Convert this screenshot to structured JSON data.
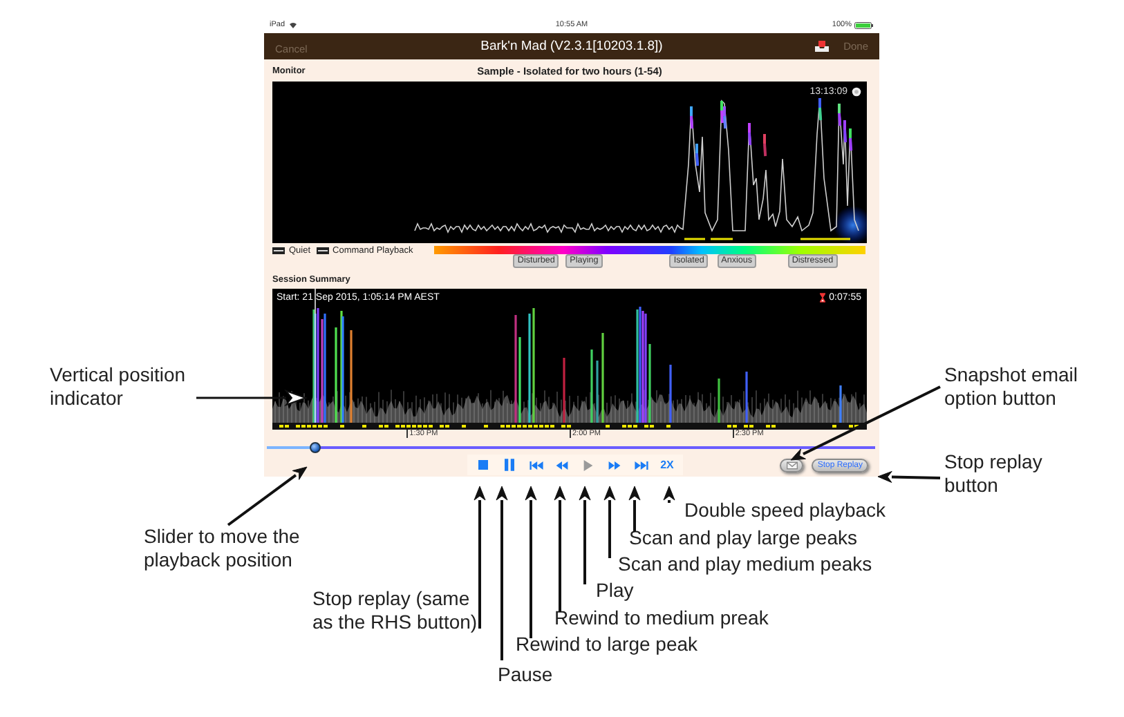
{
  "status_bar": {
    "device": "iPad",
    "time": "10:55 AM",
    "battery": "100%"
  },
  "nav_bar": {
    "cancel": {
      "label": "Cancel",
      "disabled": true
    },
    "title": "Bark'n Mad (V2.3.1[10203.1.8])",
    "done": {
      "label": "Done",
      "disabled": true
    }
  },
  "monitor": {
    "heading": "Monitor",
    "title": "Sample - Isolated for two hours (1-54)",
    "clock": "13:13:09"
  },
  "legend": [
    {
      "label": "Quiet"
    },
    {
      "label": "Command Playback"
    }
  ],
  "mood_labels": [
    "Disturbed",
    "Playing",
    "Isolated",
    "Anxious",
    "Distressed"
  ],
  "session_summary": {
    "heading": "Session Summary",
    "start": "Start: 21 Sep 2015, 1:05:14 PM AEST",
    "elapsed": "0:07:55",
    "time_ticks": [
      "1:30 PM",
      "2:00 PM",
      "2:30 PM"
    ]
  },
  "playback_slider": {
    "level": 0.08
  },
  "controls": [
    {
      "kind": "stop",
      "disabled": false
    },
    {
      "kind": "pause",
      "disabled": false
    },
    {
      "kind": "skip_back",
      "disabled": false
    },
    {
      "kind": "rewind",
      "disabled": false
    },
    {
      "kind": "play",
      "disabled": true
    },
    {
      "kind": "fast_forward",
      "disabled": false
    },
    {
      "kind": "skip_forward",
      "disabled": false
    },
    {
      "kind": "speed",
      "label": "2X",
      "disabled": false
    }
  ],
  "stop_replay_button": {
    "label": "Stop Replay"
  },
  "annotations": [
    {
      "text": "Vertical position indicator"
    },
    {
      "text": "Snapshot email option button"
    },
    {
      "text": "Stop replay button"
    },
    {
      "text": "Double speed playback"
    },
    {
      "text": "Slider to move the playback position"
    },
    {
      "text": "Scan and play large peaks"
    },
    {
      "text": "Scan and play medium peaks"
    },
    {
      "text": "Play"
    },
    {
      "text": "Stop replay (same as the RHS button)"
    },
    {
      "text": "Rewind to medium preak"
    },
    {
      "text": "Rewind to large peak"
    },
    {
      "text": "Pause"
    }
  ]
}
